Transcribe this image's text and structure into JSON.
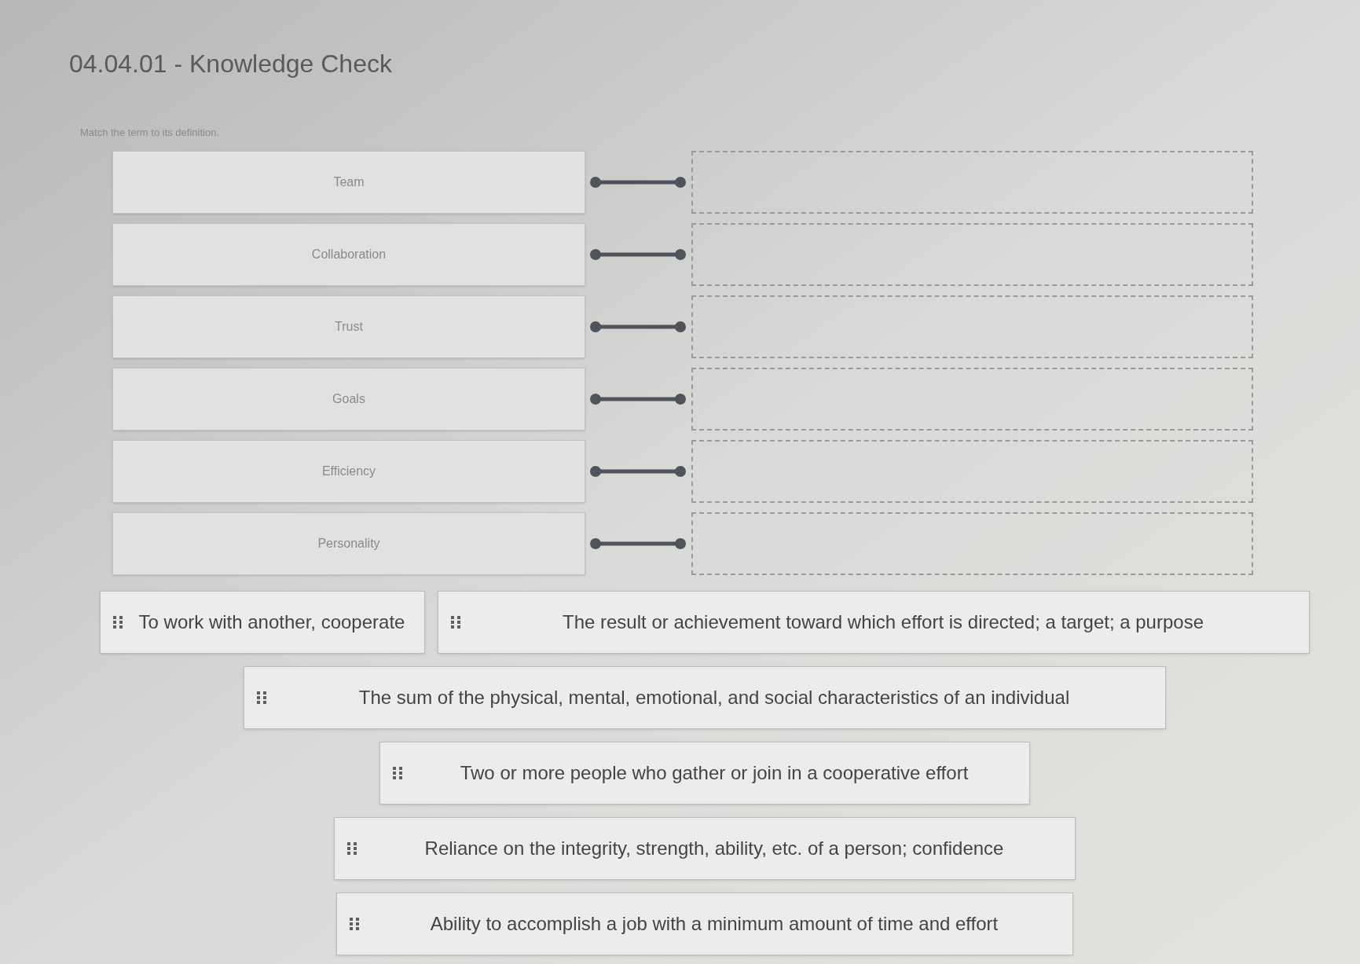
{
  "title": "04.04.01 - Knowledge Check",
  "instructions": "Match the term to its definition.",
  "terms": [
    {
      "label": "Team"
    },
    {
      "label": "Collaboration"
    },
    {
      "label": "Trust"
    },
    {
      "label": "Goals"
    },
    {
      "label": "Efficiency"
    },
    {
      "label": "Personality"
    }
  ],
  "definitions": [
    {
      "text": "To work with another, cooperate"
    },
    {
      "text": "The result or achievement toward which effort is directed; a target; a purpose"
    },
    {
      "text": "The sum of the physical, mental, emotional, and social characteristics of an individual"
    },
    {
      "text": "Two or more people who gather or join in a cooperative effort"
    },
    {
      "text": "Reliance on the integrity, strength, ability, etc. of a person; confidence"
    },
    {
      "text": "Ability to accomplish a job with a minimum amount of time and effort"
    }
  ]
}
